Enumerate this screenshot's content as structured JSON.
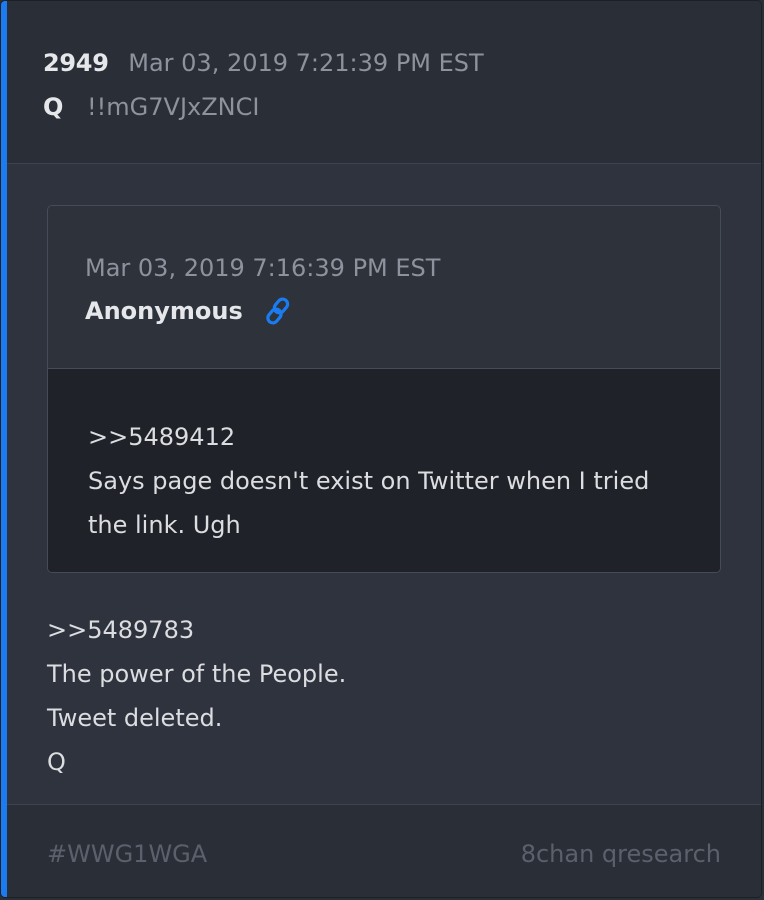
{
  "post": {
    "number": "2949",
    "timestamp": "Mar 03, 2019 7:21:39 PM EST",
    "author": "Q",
    "tripcode": "!!mG7VJxZNCI",
    "body_lines": [
      ">>5489783",
      "The power of the People.",
      "Tweet deleted.",
      "Q"
    ]
  },
  "quote": {
    "timestamp": "Mar 03, 2019 7:16:39 PM EST",
    "author": "Anonymous",
    "link_icon": "link-icon",
    "body_lines": [
      ">>5489412",
      "Says page doesn't exist on Twitter when I tried the link. Ugh"
    ]
  },
  "footer": {
    "hashtag": "#WWG1WGA",
    "source": "8chan qresearch"
  },
  "colors": {
    "accent": "#1a7cf0",
    "link": "#1a7cf0"
  }
}
